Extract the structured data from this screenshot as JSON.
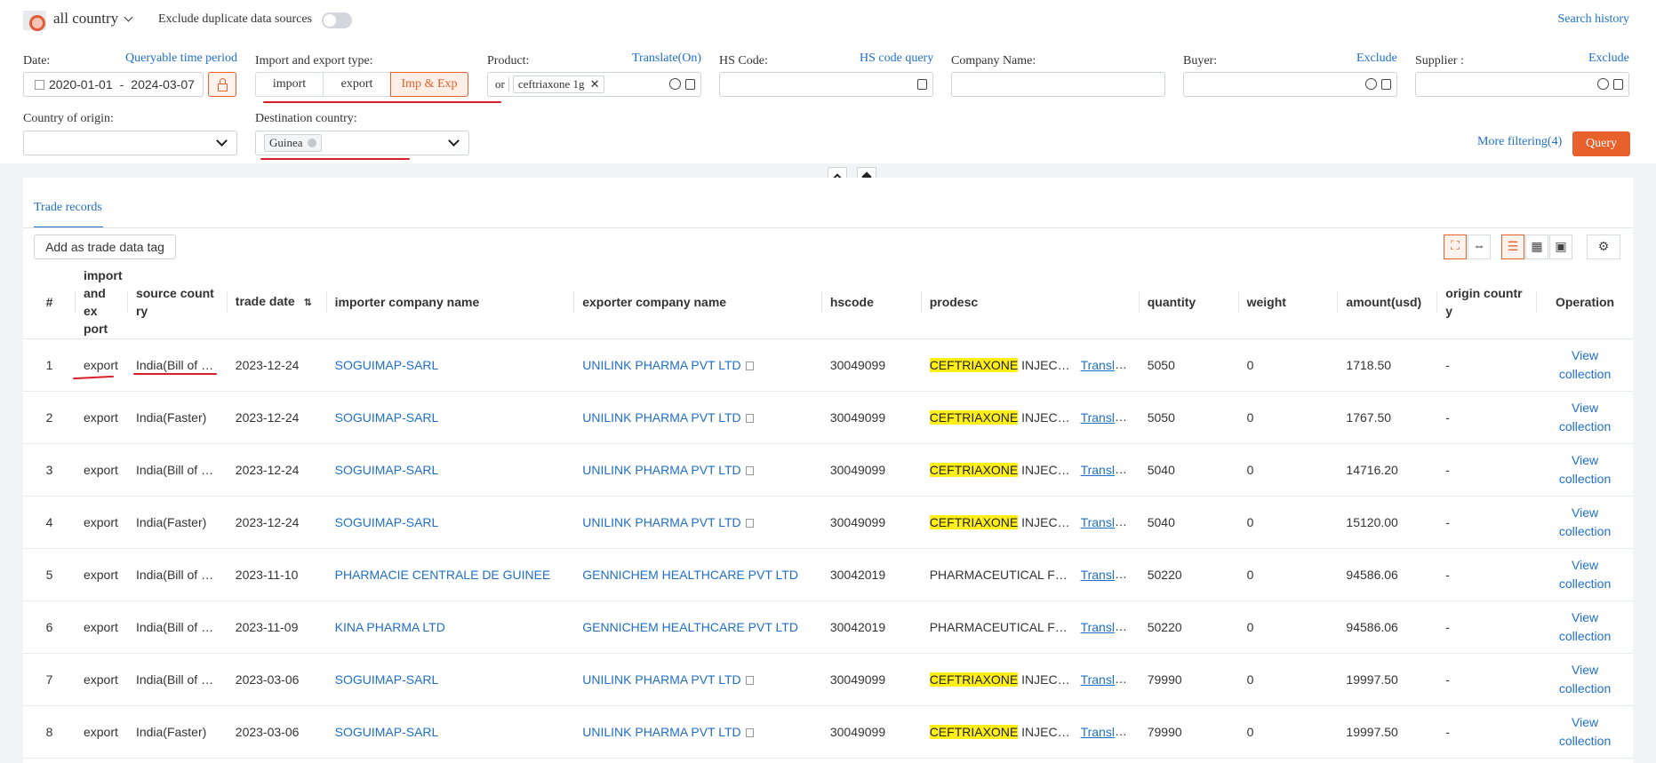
{
  "header": {
    "country_selector": "all country",
    "exclude_duplicates_label": "Exclude duplicate data sources",
    "search_history": "Search history"
  },
  "filters": {
    "date": {
      "label": "Date:",
      "link": "Queryable time period",
      "start": "2020-01-01",
      "separator": "-",
      "end": "2024-03-07"
    },
    "trade_type": {
      "label": "Import and export type:",
      "options": [
        "import",
        "export",
        "Imp & Exp"
      ],
      "selected": "Imp & Exp"
    },
    "product": {
      "label": "Product:",
      "link": "Translate(On)",
      "mode": "or",
      "tag": "ceftriaxone 1g"
    },
    "hs_code": {
      "label": "HS Code:",
      "link": "HS code query",
      "value": ""
    },
    "company_name": {
      "label": "Company Name:",
      "value": ""
    },
    "buyer": {
      "label": "Buyer:",
      "link": "Exclude",
      "value": ""
    },
    "supplier": {
      "label": "Supplier :",
      "link": "Exclude",
      "value": ""
    },
    "country_of_origin": {
      "label": "Country of origin:",
      "value": ""
    },
    "destination_country": {
      "label": "Destination country:",
      "tag": "Guinea"
    },
    "more_filtering": "More filtering(4)",
    "query_button": "Query"
  },
  "records": {
    "tab": "Trade records",
    "add_tag_button": "Add as trade data tag",
    "columns": [
      "#",
      "import and ex port",
      "source count ry",
      "trade date",
      "importer company name",
      "exporter company name",
      "hscode",
      "prodesc",
      "quantity",
      "weight",
      "amount(usd)",
      "origin countr y",
      "Operation"
    ],
    "rows": [
      {
        "n": "1",
        "type": "export",
        "source": "India(Bill of Lading)",
        "date": "2023-12-24",
        "importer": "SOGUIMAP-SARL",
        "exporter": "UNILINK PHARMA PVT LTD",
        "hscode": "30049099",
        "prod_hl": "CEFTRIAXONE",
        "prod_rest": " INJECTION",
        "translate": "Translate",
        "qty": "5050",
        "weight": "0",
        "amount": "1718.50",
        "origin": "-",
        "op": "View collection"
      },
      {
        "n": "2",
        "type": "export",
        "source": "India(Faster)",
        "date": "2023-12-24",
        "importer": "SOGUIMAP-SARL",
        "exporter": "UNILINK PHARMA PVT LTD",
        "hscode": "30049099",
        "prod_hl": "CEFTRIAXONE",
        "prod_rest": " INJECTION",
        "translate": "Translate",
        "qty": "5050",
        "weight": "0",
        "amount": "1767.50",
        "origin": "-",
        "op": "View collection"
      },
      {
        "n": "3",
        "type": "export",
        "source": "India(Bill of Lading)",
        "date": "2023-12-24",
        "importer": "SOGUIMAP-SARL",
        "exporter": "UNILINK PHARMA PVT LTD",
        "hscode": "30049099",
        "prod_hl": "CEFTRIAXONE",
        "prod_rest": " INJECTION",
        "translate": "Translate",
        "qty": "5040",
        "weight": "0",
        "amount": "14716.20",
        "origin": "-",
        "op": "View collection"
      },
      {
        "n": "4",
        "type": "export",
        "source": "India(Faster)",
        "date": "2023-12-24",
        "importer": "SOGUIMAP-SARL",
        "exporter": "UNILINK PHARMA PVT LTD",
        "hscode": "30049099",
        "prod_hl": "CEFTRIAXONE",
        "prod_rest": " INJECTION",
        "translate": "Translate",
        "qty": "5040",
        "weight": "0",
        "amount": "15120.00",
        "origin": "-",
        "op": "View collection"
      },
      {
        "n": "5",
        "type": "export",
        "source": "India(Bill of Lading)",
        "date": "2023-11-10",
        "importer": "PHARMACIE CENTRALE DE GUINEE",
        "exporter": "GENNICHEM HEALTHCARE PVT LTD",
        "hscode": "30042019",
        "prod_hl": "",
        "prod_rest": "PHARMACEUTICAL FORMULATION",
        "translate": "Translate",
        "qty": "50220",
        "weight": "0",
        "amount": "94586.06",
        "origin": "-",
        "op": "View collection"
      },
      {
        "n": "6",
        "type": "export",
        "source": "India(Bill of Lading)",
        "date": "2023-11-09",
        "importer": "KINA PHARMA LTD",
        "exporter": "GENNICHEM HEALTHCARE PVT LTD",
        "hscode": "30042019",
        "prod_hl": "",
        "prod_rest": "PHARMACEUTICAL FORMULATION",
        "translate": "Translate",
        "qty": "50220",
        "weight": "0",
        "amount": "94586.06",
        "origin": "-",
        "op": "View collection"
      },
      {
        "n": "7",
        "type": "export",
        "source": "India(Bill of Lading)",
        "date": "2023-03-06",
        "importer": "SOGUIMAP-SARL",
        "exporter": "UNILINK PHARMA PVT LTD",
        "hscode": "30049099",
        "prod_hl": "CEFTRIAXONE",
        "prod_rest": " INJECTION",
        "translate": "Translate",
        "qty": "79990",
        "weight": "0",
        "amount": "19997.50",
        "origin": "-",
        "op": "View collection"
      },
      {
        "n": "8",
        "type": "export",
        "source": "India(Faster)",
        "date": "2023-03-06",
        "importer": "SOGUIMAP-SARL",
        "exporter": "UNILINK PHARMA PVT LTD",
        "hscode": "30049099",
        "prod_hl": "CEFTRIAXONE",
        "prod_rest": " INJECTION",
        "translate": "Translate",
        "qty": "79990",
        "weight": "0",
        "amount": "19997.50",
        "origin": "-",
        "op": "View collection"
      }
    ]
  },
  "colors": {
    "accent": "#e8612c",
    "link": "#1f6fc9",
    "highlight": "#ffef17",
    "annotation": "#d8202a"
  }
}
